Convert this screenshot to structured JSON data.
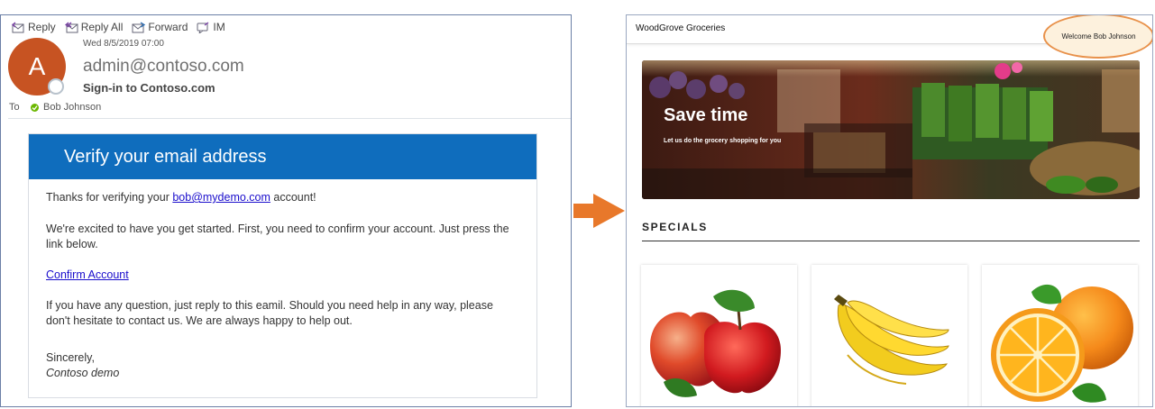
{
  "email": {
    "toolbar": {
      "reply": "Reply",
      "reply_all": "Reply All",
      "forward": "Forward",
      "im": "IM"
    },
    "avatar_letter": "A",
    "date": "Wed 8/5/2019 07:00",
    "sender": "admin@contoso.com",
    "subject": "Sign-in to Contoso.com",
    "to_label": "To",
    "to_name": "Bob Johnson",
    "banner_title": "Verify your email address",
    "body": {
      "line1_prefix": "Thanks for verifying your ",
      "line1_link": "bob@mydemo.com",
      "line1_suffix": " account!",
      "line2": "We're excited to have you get started. First, you need to confirm your account. Just press the link below.",
      "confirm_link": "Confirm Account",
      "line3": "If you have any question, just reply to this eamil. Should you need help in any way, please don't hesitate to contact us. We are always happy to help out.",
      "sign_off": "Sincerely,",
      "signature": "Contoso demo"
    }
  },
  "site": {
    "brand": "WoodGrove Groceries",
    "welcome": "Welcome Bob Johnson",
    "hero": {
      "title": "Save time",
      "subtitle": "Let us do the grocery shopping for you"
    },
    "specials_heading": "SPECIALS",
    "products": [
      {
        "icon": "apples"
      },
      {
        "icon": "bananas"
      },
      {
        "icon": "oranges"
      }
    ]
  },
  "colors": {
    "banner_blue": "#0f6dbd",
    "avatar_orange": "#c75322",
    "arrow_orange": "#e8782a",
    "highlight_orange": "#e8914a",
    "link_blue": "#1a0dcc"
  }
}
